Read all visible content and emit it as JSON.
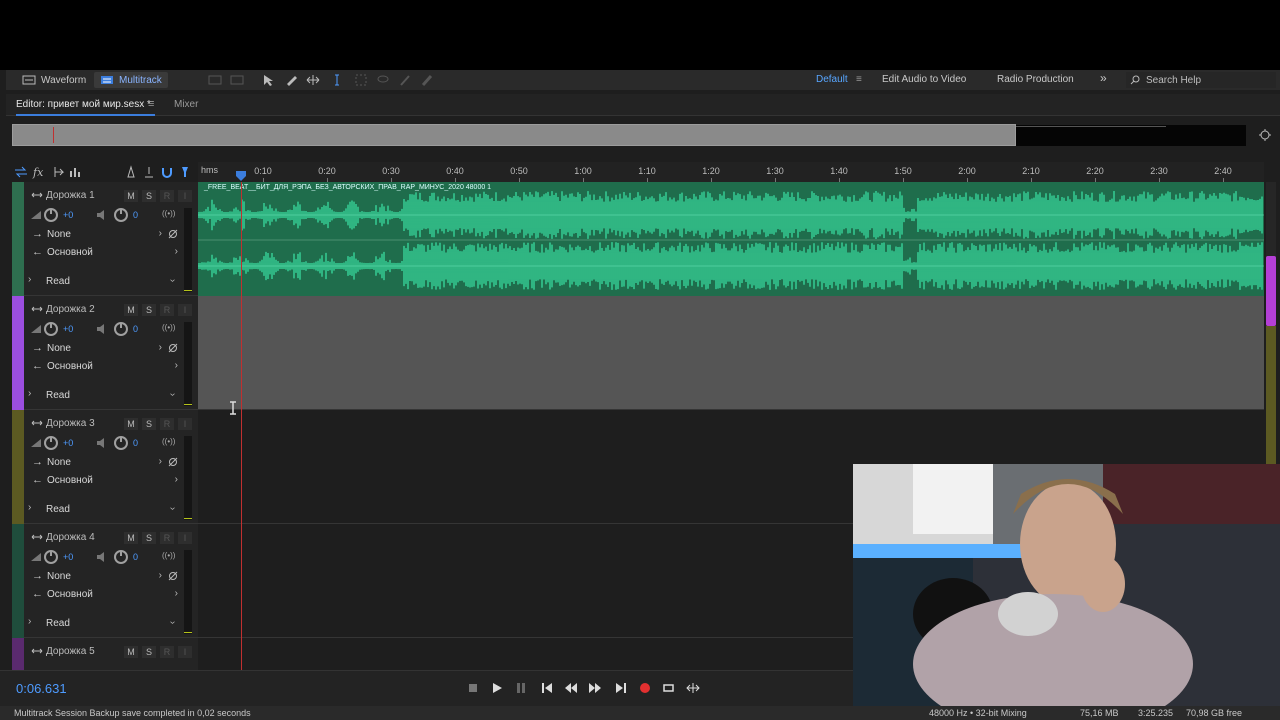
{
  "toolbar": {
    "waveform_label": "Waveform",
    "multitrack_label": "Multitrack",
    "workspaces": [
      "Default",
      "Edit Audio to Video",
      "Radio Production"
    ],
    "search_label": "Search Help"
  },
  "tabs": {
    "editor_label": "Editor: привет мой мир.sesx *",
    "mixer_label": "Mixer"
  },
  "ruler": {
    "unit": "hms",
    "ticks": [
      "0:10",
      "0:20",
      "0:30",
      "0:40",
      "0:50",
      "1:00",
      "1:10",
      "1:20",
      "1:30",
      "1:40",
      "1:50",
      "2:00",
      "2:10",
      "2:20",
      "2:30",
      "2:40"
    ]
  },
  "tracks": [
    {
      "name": "Дорожка 1",
      "volume": "+0",
      "pan": "0",
      "input": "None",
      "output": "Основной",
      "automation": "Read",
      "color": "#2e6e4f"
    },
    {
      "name": "Дорожка 2",
      "volume": "+0",
      "pan": "0",
      "input": "None",
      "output": "Основной",
      "automation": "Read",
      "color": "#9b4ee0"
    },
    {
      "name": "Дорожка 3",
      "volume": "+0",
      "pan": "0",
      "input": "None",
      "output": "Основной",
      "automation": "Read",
      "color": "#5c5a22"
    },
    {
      "name": "Дорожка 4",
      "volume": "+0",
      "pan": "0",
      "input": "None",
      "output": "Основной",
      "automation": "Read",
      "color": "#1f4d3c"
    },
    {
      "name": "Дорожка 5",
      "color": "#5a2a6e"
    }
  ],
  "track_buttons": {
    "mute": "M",
    "solo": "S",
    "record": "R",
    "input_monitor": "I"
  },
  "clip": {
    "title": "_FREE_BEAT__БИТ_ДЛЯ_РЭПА_БЕЗ_АВТОРСКИХ_ПРАВ_RAP_МИНУС_2020 48000 1",
    "color": "#1f6d4c",
    "wave_color": "#37d49a"
  },
  "transport": {
    "time": "0:06.631"
  },
  "status": {
    "message": "Multitrack Session Backup save completed in 0,02 seconds",
    "sample_rate": "48000 Hz • 32-bit Mixing",
    "size": "75,16 MB",
    "duration": "3:25.235",
    "free": "70,98 GB free"
  },
  "colors": {
    "accent": "#4e9bff",
    "playhead": "#c03030"
  }
}
